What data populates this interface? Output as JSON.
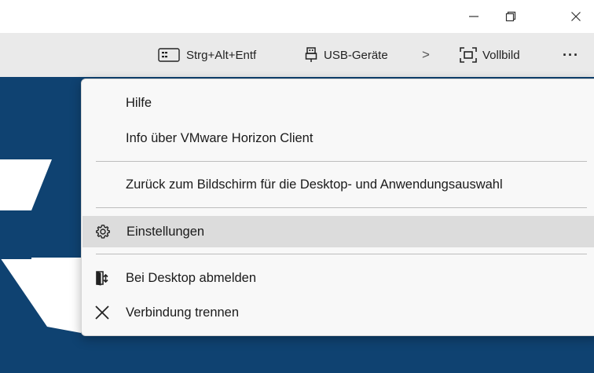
{
  "window": {
    "controls": {
      "minimize_glyph": "–",
      "restore_icon": "restore-icon",
      "close_icon": "close-icon"
    }
  },
  "toolbar": {
    "ctrl_alt_del_label": "Strg+Alt+Entf",
    "usb_label": "USB-Geräte",
    "fullscreen_label": "Vollbild",
    "more_glyph": "···",
    "next_glyph": ">"
  },
  "menu": {
    "items": [
      {
        "label": "Hilfe"
      },
      {
        "label": "Info über VMware Horizon Client"
      },
      {
        "label": "Zurück zum Bildschirm für die Desktop- und Anwendungsauswahl"
      },
      {
        "label": "Einstellungen",
        "icon": "gear-icon",
        "highlighted": true
      },
      {
        "label": "Bei Desktop abmelden",
        "icon": "logoff-icon"
      },
      {
        "label": "Verbindung trennen",
        "icon": "close-icon"
      }
    ]
  },
  "colors": {
    "remote_background": "#0f4271",
    "toolbar_background": "#eaeaea",
    "menu_background": "#f8f8f8",
    "highlight": "#dcdcdc"
  }
}
